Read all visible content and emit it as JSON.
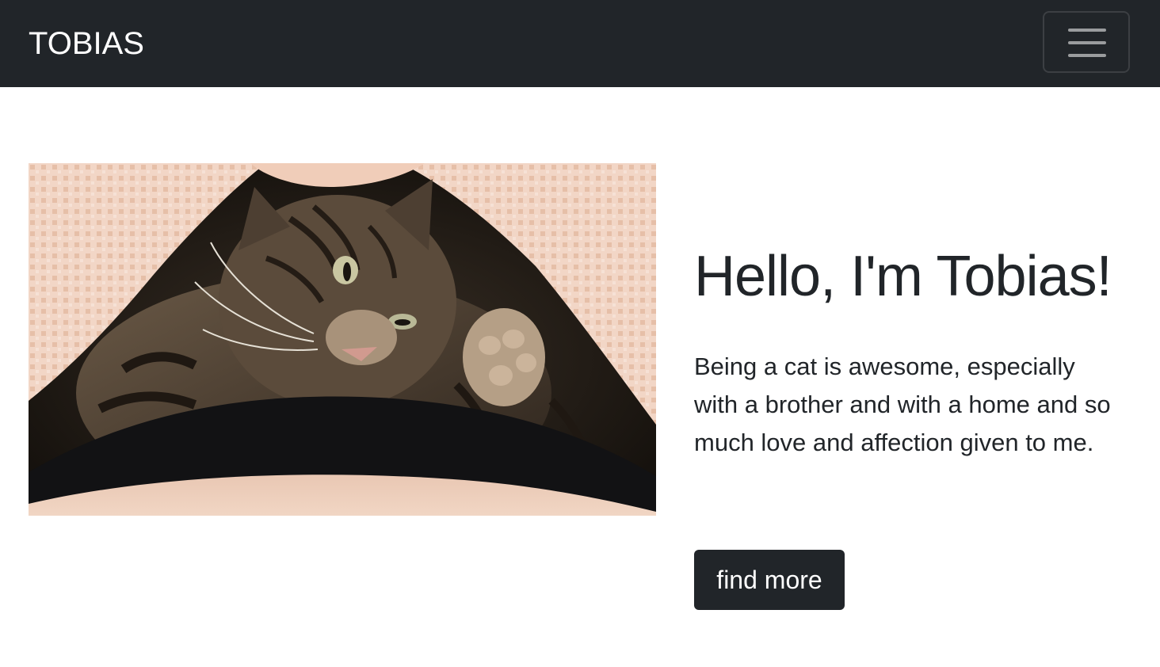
{
  "navbar": {
    "brand": "TOBIAS",
    "toggler_icon": "hamburger-menu-icon"
  },
  "hero": {
    "image_subject": "tabby cat lying under a pink blanket",
    "headline": "Hello, I'm Tobias!",
    "lead": "Being a cat is awesome, especially with a brother and with a home and so much love and affection given to me.",
    "button_label": "find more"
  },
  "colors": {
    "navbar_bg": "#212529",
    "text": "#212529",
    "button_bg": "#212529",
    "button_text": "#ffffff",
    "page_bg": "#ffffff"
  }
}
